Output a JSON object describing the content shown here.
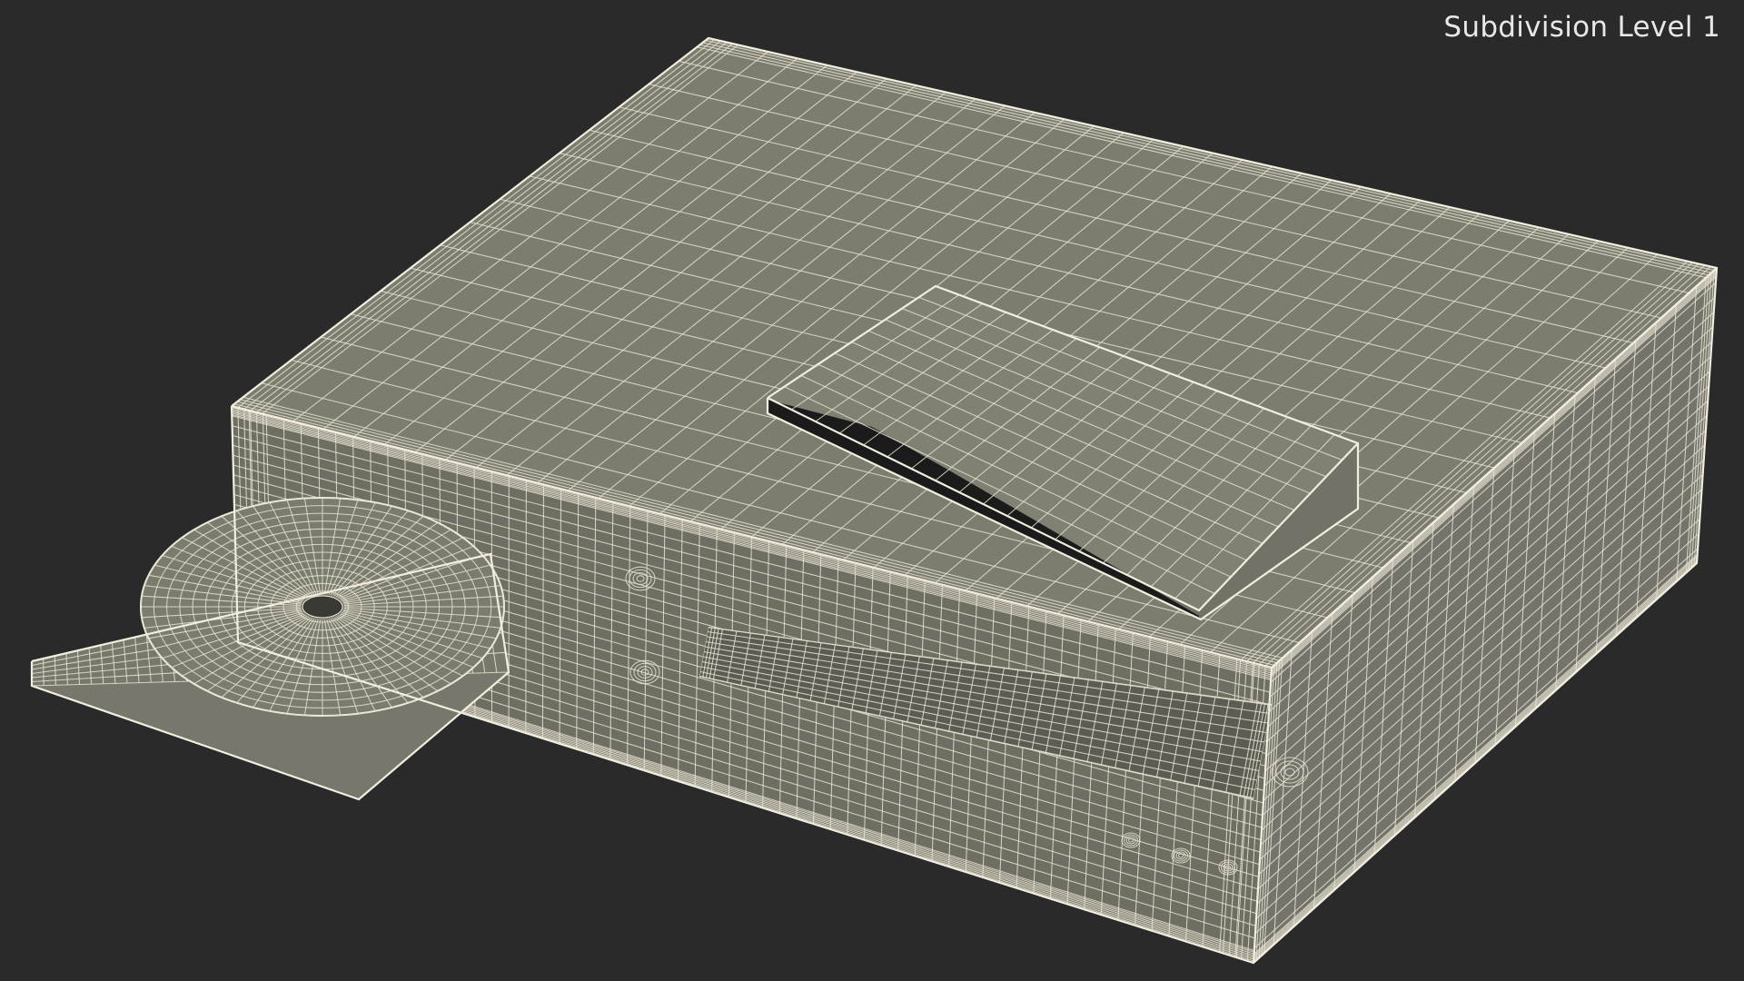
{
  "viewport": {
    "label": "Subdivision Level 1",
    "background_color": "#2a2a2a",
    "surface_color": "#7d7d70",
    "wire_color": "#e7e3d2"
  }
}
